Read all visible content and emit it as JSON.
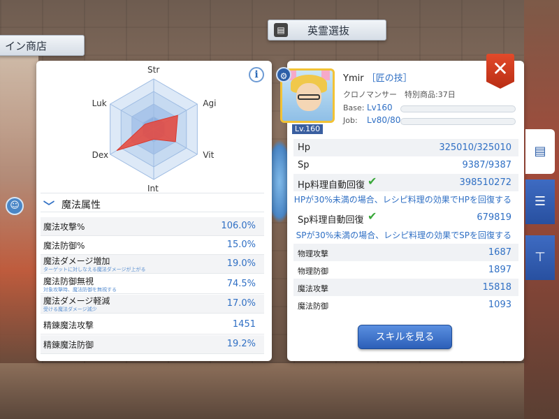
{
  "background": {
    "signs": {
      "shop": "イン商店",
      "hero": "英霊選抜"
    }
  },
  "left_panel": {
    "radar_labels": [
      "Str",
      "Agi",
      "Vit",
      "Int",
      "Dex",
      "Luk"
    ],
    "radar_values": [
      0.15,
      0.55,
      0.5,
      0.2,
      0.85,
      0.2
    ],
    "section_title": "魔法属性",
    "attributes": [
      {
        "name": "魔法攻撃%",
        "sub": "",
        "value": "106.0%"
      },
      {
        "name": "魔法防御%",
        "sub": "",
        "value": "15.0%"
      },
      {
        "name": "魔法ダメージ増加",
        "sub": "ターゲットに対しなえる魔法ダメージが上がる",
        "value": "19.0%"
      },
      {
        "name": "魔法防御無視",
        "sub": "対象攻撃時、魔法防御を無視する",
        "value": "74.5%"
      },
      {
        "name": "魔法ダメージ軽減",
        "sub": "受ける魔法ダメージ減少",
        "value": "17.0%"
      },
      {
        "name": "精錬魔法攻撃",
        "sub": "",
        "value": "1451"
      },
      {
        "name": "精錬魔法防御",
        "sub": "",
        "value": "19.2%"
      }
    ]
  },
  "character": {
    "name": "Ymir",
    "title": "［匠の技］",
    "job": "クロノマンサー　特別商品:37日",
    "level_badge": "Lv.160",
    "base_label": "Base:",
    "base_value": "Lv160",
    "job_label": "Job:",
    "job_value": "Lv80/80"
  },
  "stats": {
    "hp_label": "Hp",
    "hp_value": "325010/325010",
    "sp_label": "Sp",
    "sp_value": "9387/9387",
    "hp_auto_label": "Hp料理自動回復",
    "hp_auto_value": "398510272",
    "hp_auto_note": "HPが30%未満の場合、レシピ料理の効果でHPを回復する",
    "sp_auto_label": "Sp料理自動回復",
    "sp_auto_value": "679819",
    "sp_auto_note": "SPが30%未満の場合、レシピ料理の効果でSPを回復する",
    "phys_atk_label": "物理攻撃",
    "phys_atk_value": "1687",
    "phys_def_label": "物理防御",
    "phys_def_value": "1897",
    "mag_atk_label": "魔法攻撃",
    "mag_atk_value": "15818",
    "mag_def_label": "魔法防御",
    "mag_def_value": "1093"
  },
  "buttons": {
    "skill": "スキルを見る",
    "close": "✕",
    "info": "i"
  },
  "icons": [
    "info-icon",
    "close-icon",
    "gear-icon",
    "check-icon",
    "clipboard-icon",
    "sliders-icon",
    "hierarchy-icon",
    "chevron-down-icon",
    "chat-icon"
  ],
  "colors": {
    "accent": "#2f6fc4",
    "close": "#d63a1e",
    "button": "#2c5fb8"
  }
}
